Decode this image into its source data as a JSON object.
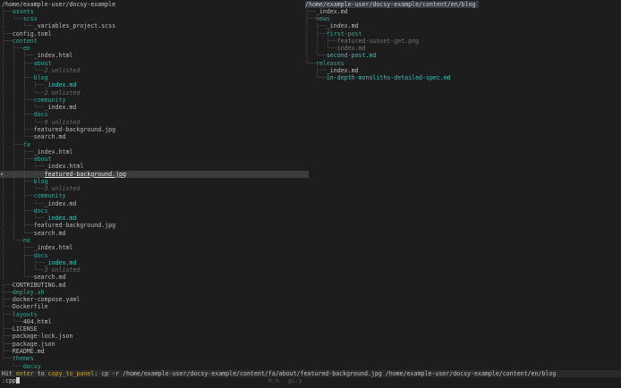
{
  "colors": {
    "background": "#1d1d1d",
    "directory": "#3aa395",
    "git_modified": "#30c5bb",
    "dim": "#757575",
    "tree_lines": "#4d4d4d",
    "selection_bg": "#3b3b3b",
    "panel_title_bg": "#343b41",
    "status_bg": "#2a2a2a",
    "keyword_gold": "#c2a23a"
  },
  "icons": {
    "selection_marker": "▶",
    "cursor_block": "block-cursor"
  },
  "left_panel": {
    "title": "/home/example-user/docsy-example",
    "rows": [
      {
        "p": "├──",
        "n": "assets",
        "s": "dir"
      },
      {
        "p": "│  └──",
        "n": "scss",
        "s": "dir"
      },
      {
        "p": "│     └──",
        "n": "_variables_project.scss",
        "s": "file"
      },
      {
        "p": "├──",
        "n": "config.toml",
        "s": "file"
      },
      {
        "p": "├──",
        "n": "content",
        "s": "dir"
      },
      {
        "p": "│  ├──",
        "n": "en",
        "s": "dir"
      },
      {
        "p": "│  │  ├──",
        "n": "_index.html",
        "s": "file"
      },
      {
        "p": "│  │  ├──",
        "n": "about",
        "s": "dir"
      },
      {
        "p": "│  │  │  └──",
        "n": "2 unlisted",
        "s": "unlisted"
      },
      {
        "p": "│  │  ├──",
        "n": "blog",
        "s": "dir"
      },
      {
        "p": "│  │  │  ├──",
        "n": "_index.md",
        "s": "mod"
      },
      {
        "p": "│  │  │  └──",
        "n": "2 unlisted",
        "s": "unlisted"
      },
      {
        "p": "│  │  ├──",
        "n": "community",
        "s": "dir"
      },
      {
        "p": "│  │  │  └──",
        "n": "_index.md",
        "s": "file"
      },
      {
        "p": "│  │  ├──",
        "n": "docs",
        "s": "dir"
      },
      {
        "p": "│  │  │  └──",
        "n": "9 unlisted",
        "s": "unlisted"
      },
      {
        "p": "│  │  ├──",
        "n": "featured-background.jpg",
        "s": "file"
      },
      {
        "p": "│  │  └──",
        "n": "search.md",
        "s": "file"
      },
      {
        "p": "│  ├──",
        "n": "fa",
        "s": "dir"
      },
      {
        "p": "│  │  ├──",
        "n": "_index.html",
        "s": "file"
      },
      {
        "p": "│  │  ├──",
        "n": "about",
        "s": "dir"
      },
      {
        "p": "│  │  │  ├──",
        "n": "_index.html",
        "s": "file"
      },
      {
        "p": "│  │  │  └──",
        "n": "featured-background.jpg",
        "s": "file",
        "selected": true
      },
      {
        "p": "│  │  ├──",
        "n": "blog",
        "s": "dir"
      },
      {
        "p": "│  │  │  └──",
        "n": "3 unlisted",
        "s": "unlisted"
      },
      {
        "p": "│  │  ├──",
        "n": "community",
        "s": "dir"
      },
      {
        "p": "│  │  │  └──",
        "n": "_index.md",
        "s": "file"
      },
      {
        "p": "│  │  ├──",
        "n": "docs",
        "s": "dir"
      },
      {
        "p": "│  │  │  └──",
        "n": "_index.md",
        "s": "mod"
      },
      {
        "p": "│  │  ├──",
        "n": "featured-background.jpg",
        "s": "file"
      },
      {
        "p": "│  │  └──",
        "n": "search.md",
        "s": "file"
      },
      {
        "p": "│  └──",
        "n": "no",
        "s": "dir"
      },
      {
        "p": "│     ├──",
        "n": "_index.html",
        "s": "file"
      },
      {
        "p": "│     ├──",
        "n": "docs",
        "s": "dir"
      },
      {
        "p": "│     │  ├──",
        "n": "_index.md",
        "s": "mod"
      },
      {
        "p": "│     │  └──",
        "n": "3 unlisted",
        "s": "unlisted"
      },
      {
        "p": "│     └──",
        "n": "search.md",
        "s": "file"
      },
      {
        "p": "├──",
        "n": "CONTRIBUTING.md",
        "s": "file"
      },
      {
        "p": "├──",
        "n": "deploy.sh",
        "s": "exec"
      },
      {
        "p": "├──",
        "n": "docker-compose.yaml",
        "s": "file"
      },
      {
        "p": "├──",
        "n": "Dockerfile",
        "s": "file"
      },
      {
        "p": "├──",
        "n": "layouts",
        "s": "dir"
      },
      {
        "p": "│  └──",
        "n": "404.html",
        "s": "file"
      },
      {
        "p": "├──",
        "n": "LICENSE",
        "s": "file"
      },
      {
        "p": "├──",
        "n": "package-lock.json",
        "s": "file"
      },
      {
        "p": "├──",
        "n": "package.json",
        "s": "file"
      },
      {
        "p": "├──",
        "n": "README.md",
        "s": "file"
      },
      {
        "p": "└──",
        "n": "themes",
        "s": "dir"
      },
      {
        "p": "   └──",
        "n": "docsy",
        "s": "dir"
      }
    ]
  },
  "right_panel": {
    "title": "/home/example-user/docsy-example/content/en/blog",
    "rows": [
      {
        "p": "├──",
        "n": "_index.md",
        "s": "file"
      },
      {
        "p": "├──",
        "n": "news",
        "s": "dir"
      },
      {
        "p": "│  ├──",
        "n": "_index.md",
        "s": "file"
      },
      {
        "p": "│  ├──",
        "n": "first-post",
        "s": "dir"
      },
      {
        "p": "│  │  ├──",
        "n": "featured-sunset-get.png",
        "s": "dim"
      },
      {
        "p": "│  │  └──",
        "n": "index.md",
        "s": "dim"
      },
      {
        "p": "│  └──",
        "n": "second-post.md",
        "s": "mod"
      },
      {
        "p": "└──",
        "n": "releases",
        "s": "dir"
      },
      {
        "p": "   ├──",
        "n": "_index.md",
        "s": "file"
      },
      {
        "p": "   └──",
        "n": "in-depth-monoliths-detailed-spec.md",
        "s": "mod"
      }
    ]
  },
  "status_bar": {
    "hit": "Hit ",
    "key": "enter",
    "to": " to ",
    "action": "copy_to_panel",
    "command": ": cp -r /home/example-user/docsy-example/content/fa/about/featured-background.jpg /home/example-user/docsy-example/content/en/blog"
  },
  "input_bar": {
    "value": ":cpp",
    "hint_hidden": "h:n",
    "hint_gitignore": "gi:y"
  }
}
